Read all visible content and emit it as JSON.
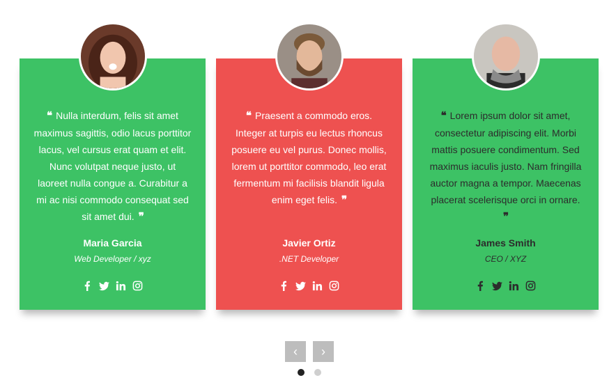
{
  "testimonials": [
    {
      "quote": "Nulla interdum, felis sit amet maximus sagittis, odio lacus porttitor lacus, vel cursus erat quam et elit. Nunc volutpat neque justo, ut laoreet nulla congue a. Curabitur a mi ac nisi commodo consequat sed sit amet dui.",
      "name": "Maria Garcia",
      "role": "Web Developer / xyz",
      "card_color": "#3dc265"
    },
    {
      "quote": "Praesent a commodo eros. Integer at turpis eu lectus rhoncus posuere eu vel purus. Donec mollis, lorem ut porttitor commodo, leo erat fermentum mi facilisis blandit ligula enim eget felis.",
      "name": "Javier Ortiz",
      "role": ".NET Developer",
      "card_color": "#ee5150"
    },
    {
      "quote": "Lorem ipsum dolor sit amet, consectetur adipiscing elit. Morbi mattis posuere condimentum. Sed maximus iaculis justo. Nam fringilla auctor magna a tempor. Maecenas placerat scelerisque orci in ornare.",
      "name": "James Smith",
      "role": "CEO / XYZ",
      "card_color": "#3dc265"
    }
  ],
  "icons": {
    "quote_open": "quote-left-icon",
    "quote_close": "quote-right-icon",
    "social": [
      "facebook-icon",
      "twitter-icon",
      "linkedin-icon",
      "instagram-icon"
    ],
    "prev": "chevron-left-icon",
    "next": "chevron-right-icon"
  },
  "pagination": {
    "total": 2,
    "active": 1
  }
}
